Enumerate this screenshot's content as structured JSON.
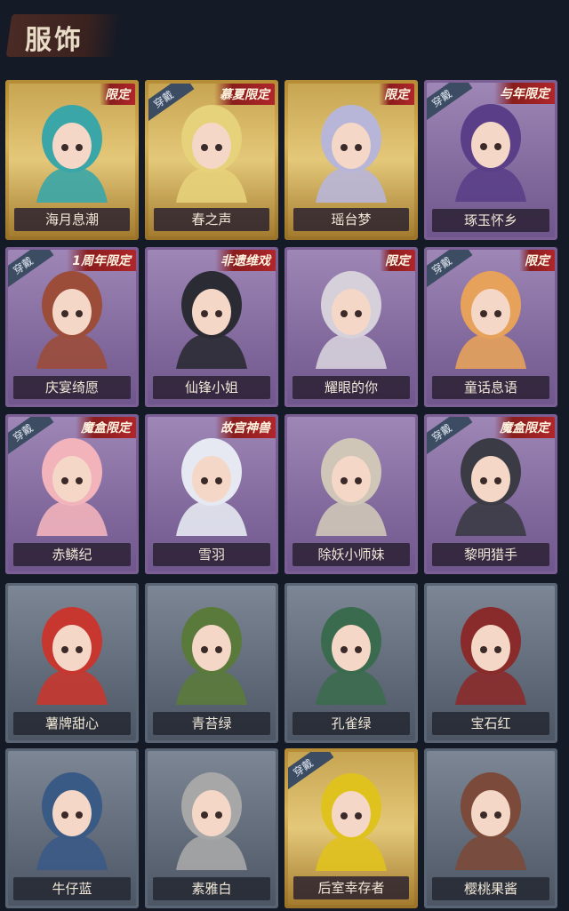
{
  "page": {
    "title": "服饰"
  },
  "tags": {
    "wearing": "穿戴"
  },
  "outfits": [
    {
      "name": "海月息潮",
      "tier": "gold",
      "limited": "限定",
      "wearing": false,
      "color": "#3aa6a8"
    },
    {
      "name": "春之声",
      "tier": "gold",
      "limited": "慕夏限定",
      "wearing": true,
      "color": "#e6d27a"
    },
    {
      "name": "瑶台梦",
      "tier": "gold",
      "limited": "限定",
      "wearing": false,
      "color": "#b8b6d8"
    },
    {
      "name": "琢玉怀乡",
      "tier": "purple",
      "limited": "与年限定",
      "wearing": true,
      "color": "#5a3f88"
    },
    {
      "name": "庆宴绮愿",
      "tier": "purple",
      "limited": "1周年限定",
      "wearing": true,
      "color": "#9b4d3a"
    },
    {
      "name": "仙锋小姐",
      "tier": "purple",
      "limited": "非遗维戏",
      "wearing": false,
      "color": "#2b2b34"
    },
    {
      "name": "耀眼的你",
      "tier": "purple",
      "limited": "限定",
      "wearing": false,
      "color": "#d6d0da"
    },
    {
      "name": "童话息语",
      "tier": "purple",
      "limited": "限定",
      "wearing": true,
      "color": "#e6a25b"
    },
    {
      "name": "赤鳞纪",
      "tier": "purple",
      "limited": "魔盒限定",
      "wearing": true,
      "color": "#f2b3bb"
    },
    {
      "name": "雪羽",
      "tier": "purple",
      "limited": "故宫神兽",
      "wearing": false,
      "color": "#e6e9f2"
    },
    {
      "name": "除妖小师妹",
      "tier": "purple",
      "limited": "",
      "wearing": false,
      "color": "#cfc6b8"
    },
    {
      "name": "黎明猎手",
      "tier": "purple",
      "limited": "魔盒限定",
      "wearing": true,
      "color": "#3b3b45"
    },
    {
      "name": "薯牌甜心",
      "tier": "grey",
      "limited": "",
      "wearing": false,
      "color": "#c7372f"
    },
    {
      "name": "青苔绿",
      "tier": "grey",
      "limited": "",
      "wearing": false,
      "color": "#5a7a3b"
    },
    {
      "name": "孔雀绿",
      "tier": "grey",
      "limited": "",
      "wearing": false,
      "color": "#3b6b4e"
    },
    {
      "name": "宝石红",
      "tier": "grey",
      "limited": "",
      "wearing": false,
      "color": "#8a2b2b"
    },
    {
      "name": "牛仔蓝",
      "tier": "grey",
      "limited": "",
      "wearing": false,
      "color": "#3a5a86"
    },
    {
      "name": "素雅白",
      "tier": "grey",
      "limited": "",
      "wearing": false,
      "color": "#a7a7a7"
    },
    {
      "name": "后室幸存者",
      "tier": "gold",
      "limited": "",
      "wearing": true,
      "color": "#e0c21e"
    },
    {
      "name": "樱桃果酱",
      "tier": "grey",
      "limited": "",
      "wearing": false,
      "color": "#7b4a3a"
    }
  ]
}
